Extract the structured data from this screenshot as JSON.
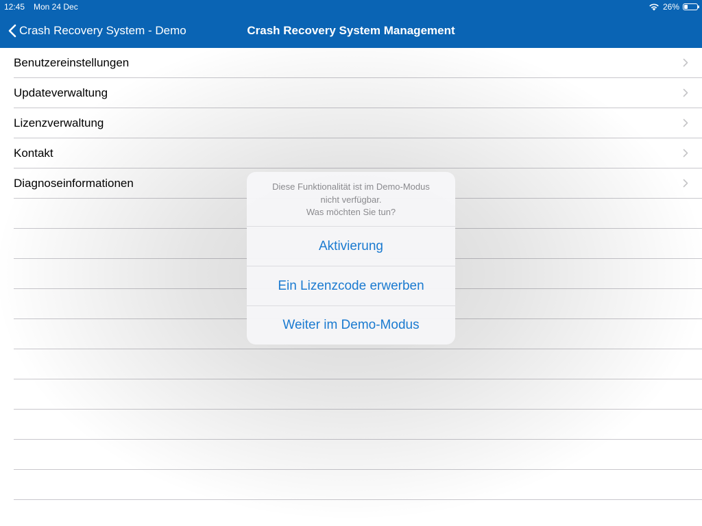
{
  "status_bar": {
    "time": "12:45",
    "date": "Mon 24 Dec",
    "battery_percent": "26%",
    "battery_level": 0.26,
    "wifi_icon": "wifi-icon",
    "battery_icon": "battery-icon"
  },
  "nav": {
    "back_label": "Crash Recovery System - Demo",
    "back_icon": "chevron-left-icon",
    "title": "Crash Recovery System Management",
    "bar_color": "#0a64b4"
  },
  "list": {
    "items": [
      {
        "label": "Benutzereinstellungen"
      },
      {
        "label": "Updateverwaltung"
      },
      {
        "label": "Lizenzverwaltung"
      },
      {
        "label": "Kontakt"
      },
      {
        "label": "Diagnoseinformationen"
      }
    ],
    "chevron_icon": "chevron-right-icon"
  },
  "alert": {
    "message_lines": [
      "Diese Funktionalität ist im Demo-Modus",
      "nicht verfügbar.",
      "Was möchten Sie tun?"
    ],
    "buttons": [
      {
        "label": "Aktivierung"
      },
      {
        "label": "Ein Lizenzcode erwerben"
      },
      {
        "label": "Weiter im Demo-Modus"
      }
    ],
    "button_color": "#1a7ad0"
  }
}
